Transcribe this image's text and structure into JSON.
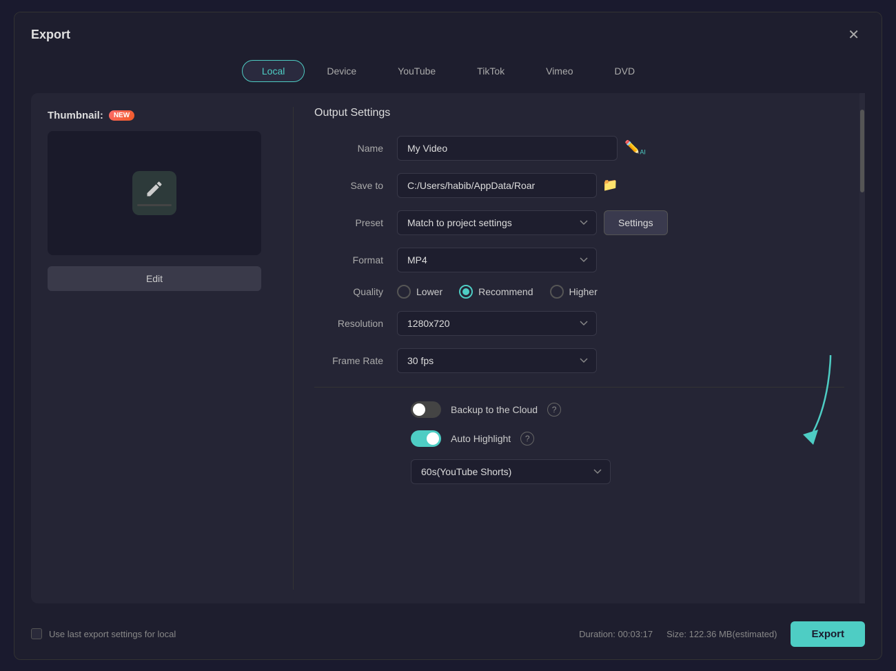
{
  "dialog": {
    "title": "Export",
    "close_label": "✕"
  },
  "tabs": {
    "items": [
      {
        "id": "local",
        "label": "Local",
        "active": true
      },
      {
        "id": "device",
        "label": "Device",
        "active": false
      },
      {
        "id": "youtube",
        "label": "YouTube",
        "active": false
      },
      {
        "id": "tiktok",
        "label": "TikTok",
        "active": false
      },
      {
        "id": "vimeo",
        "label": "Vimeo",
        "active": false
      },
      {
        "id": "dvd",
        "label": "DVD",
        "active": false
      }
    ]
  },
  "thumbnail": {
    "label": "Thumbnail:",
    "badge": "NEW",
    "edit_button": "Edit"
  },
  "output_settings": {
    "title": "Output Settings",
    "name_label": "Name",
    "name_value": "My Video",
    "save_to_label": "Save to",
    "save_to_value": "C:/Users/habib/AppData/Roar",
    "preset_label": "Preset",
    "preset_value": "Match to project settings",
    "settings_button": "Settings",
    "format_label": "Format",
    "format_value": "MP4",
    "quality_label": "Quality",
    "quality_options": [
      {
        "id": "lower",
        "label": "Lower",
        "checked": false
      },
      {
        "id": "recommend",
        "label": "Recommend",
        "checked": true
      },
      {
        "id": "higher",
        "label": "Higher",
        "checked": false
      }
    ],
    "resolution_label": "Resolution",
    "resolution_value": "1280x720",
    "frame_rate_label": "Frame Rate",
    "frame_rate_value": "30 fps",
    "backup_label": "Backup to the Cloud",
    "backup_on": false,
    "auto_highlight_label": "Auto Highlight",
    "auto_highlight_on": true,
    "highlight_duration_value": "60s(YouTube Shorts)"
  },
  "bottom": {
    "checkbox_label": "Use last export settings for local",
    "duration_label": "Duration: 00:03:17",
    "size_label": "Size: 122.36 MB(estimated)",
    "export_button": "Export"
  }
}
